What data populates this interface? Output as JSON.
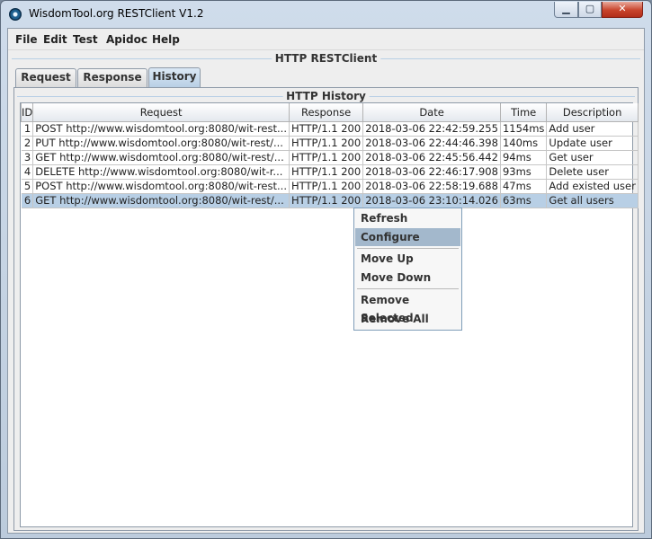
{
  "window": {
    "title": "WisdomTool.org RESTClient V1.2"
  },
  "controls": {
    "minimize": "▁",
    "maximize": "▢",
    "close": "✕"
  },
  "menu": [
    "File",
    "Edit",
    "Test",
    "Apidoc",
    "Help"
  ],
  "frame_title": "HTTP RESTClient",
  "tabs": [
    "Request",
    "Response",
    "History"
  ],
  "active_tab": "History",
  "history": {
    "title": "HTTP History",
    "columns": [
      "ID",
      "Request",
      "Response",
      "Date",
      "Time",
      "Description"
    ],
    "rows": [
      [
        "1",
        "POST http://www.wisdomtool.org:8080/wit-rest...",
        "HTTP/1.1 200",
        "2018-03-06 22:42:59.255",
        "1154ms",
        "Add user"
      ],
      [
        "2",
        "PUT http://www.wisdomtool.org:8080/wit-rest/...",
        "HTTP/1.1 200",
        "2018-03-06 22:44:46.398",
        "140ms",
        "Update user"
      ],
      [
        "3",
        "GET http://www.wisdomtool.org:8080/wit-rest/...",
        "HTTP/1.1 200",
        "2018-03-06 22:45:56.442",
        "94ms",
        "Get user"
      ],
      [
        "4",
        "DELETE http://www.wisdomtool.org:8080/wit-r...",
        "HTTP/1.1 200",
        "2018-03-06 22:46:17.908",
        "93ms",
        "Delete user"
      ],
      [
        "5",
        "POST http://www.wisdomtool.org:8080/wit-rest...",
        "HTTP/1.1 200",
        "2018-03-06 22:58:19.688",
        "47ms",
        "Add existed user"
      ],
      [
        "6",
        "GET http://www.wisdomtool.org:8080/wit-rest/...",
        "HTTP/1.1 200",
        "2018-03-06 23:10:14.026",
        "63ms",
        "Get all users"
      ]
    ],
    "selected_row": 6
  },
  "context_menu": {
    "items": [
      "Refresh",
      "Configure",
      "Move Up",
      "Move Down",
      "Remove Selected",
      "Remove All"
    ],
    "highlighted": "Configure"
  }
}
